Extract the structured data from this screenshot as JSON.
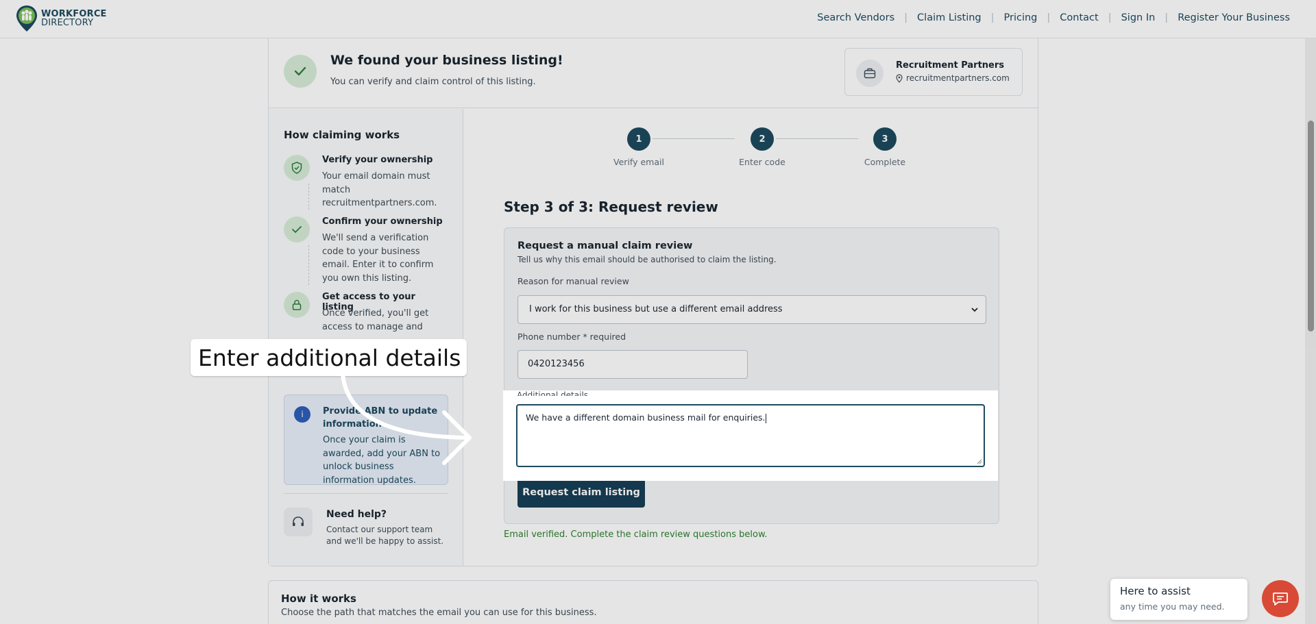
{
  "header": {
    "logo_line1": "WORKFORCE",
    "logo_line2": "DIRECTORY",
    "nav": [
      "Search Vendors",
      "Claim Listing",
      "Pricing",
      "Contact",
      "Sign In",
      "Register Your Business"
    ]
  },
  "found": {
    "title": "We found your business listing!",
    "subtitle": "You can verify and claim control of this listing.",
    "business_name": "Recruitment Partners",
    "business_domain": "recruitmentpartners.com"
  },
  "sidebar": {
    "title": "How claiming works",
    "steps": [
      {
        "title": "Verify your ownership",
        "desc": "Your email domain must match recruitmentpartners.com."
      },
      {
        "title": "Confirm your ownership",
        "desc": "We'll send a verification code to your business email. Enter it to confirm you own this listing."
      },
      {
        "title": "Get access to your listing",
        "desc": "Once verified, you'll get access to manage and update your business profile."
      }
    ],
    "abn": {
      "title": "Provide ABN to update information",
      "desc": "Once your claim is awarded, add your ABN to unlock business information updates."
    },
    "help": {
      "title": "Need help?",
      "desc": "Contact our support team and we'll be happy to assist."
    }
  },
  "stepper": [
    {
      "num": "1",
      "label": "Verify email"
    },
    {
      "num": "2",
      "label": "Enter code"
    },
    {
      "num": "3",
      "label": "Complete"
    }
  ],
  "form": {
    "heading": "Step 3 of 3: Request review",
    "box_title": "Request a manual claim review",
    "box_subtitle": "Tell us why this email should be authorised to claim the listing.",
    "reason_label": "Reason for manual review",
    "reason_value": "I work for this business but use a different email address",
    "phone_label": "Phone number * required",
    "phone_value": "0420123456",
    "details_label": "Additional details",
    "details_value": "We have a different domain business mail for enquiries.",
    "submit_label": "Request claim listing",
    "status": "Email verified. Complete the claim review questions below."
  },
  "callout": {
    "text": "Enter additional details"
  },
  "how": {
    "title": "How it works",
    "subtitle": "Choose the path that matches the email you can use for this business."
  },
  "chat": {
    "title": "Here to assist",
    "subtitle": "any time you may need."
  },
  "colors": {
    "brand": "#1d4a5f",
    "button": "#173f56",
    "success": "#2f8132",
    "chat": "#d84a36"
  }
}
